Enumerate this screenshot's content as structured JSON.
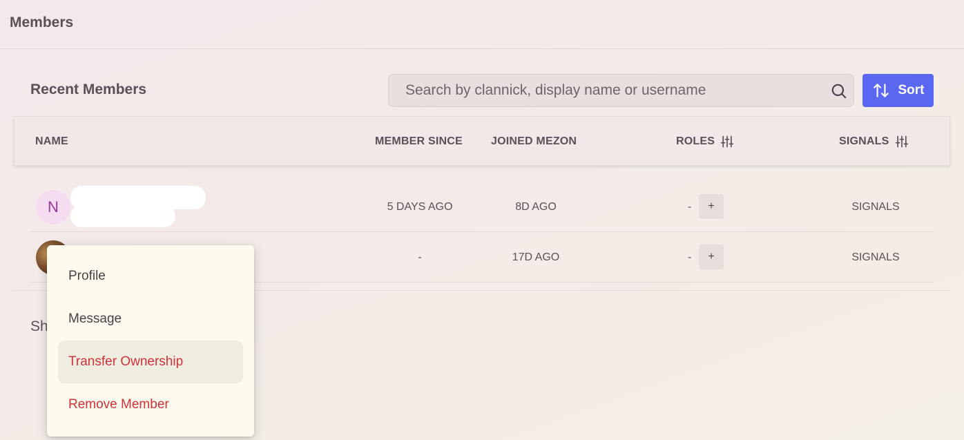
{
  "header": {
    "title": "Members"
  },
  "section": {
    "title": "Recent Members"
  },
  "search": {
    "placeholder": "Search by clannick, display name or username"
  },
  "sort": {
    "label": "Sort"
  },
  "table": {
    "columns": {
      "name": "NAME",
      "member_since": "MEMBER SINCE",
      "joined": "JOINED MEZON",
      "roles": "ROLES",
      "signals": "SIGNALS"
    },
    "rows": [
      {
        "avatar_letter": "N",
        "member_since": "5 DAYS AGO",
        "joined": "8D AGO",
        "roles": "-",
        "add_role": "+",
        "signals": "SIGNALS"
      },
      {
        "avatar_letter": "",
        "member_since": "-",
        "joined": "17D AGO",
        "roles": "-",
        "add_role": "+",
        "signals": "SIGNALS"
      }
    ]
  },
  "footer": {
    "show_text": "Sh"
  },
  "context_menu": {
    "items": [
      {
        "label": "Profile"
      },
      {
        "label": "Message"
      },
      {
        "label": "Transfer Ownership"
      },
      {
        "label": "Remove Member"
      }
    ]
  },
  "colors": {
    "accent": "#5b67f0",
    "danger": "#d0323a",
    "menu_bg": "#fefbee"
  },
  "icons": {
    "search": "search-icon",
    "sort": "sort-arrows-icon",
    "filter": "sliders-icon"
  }
}
